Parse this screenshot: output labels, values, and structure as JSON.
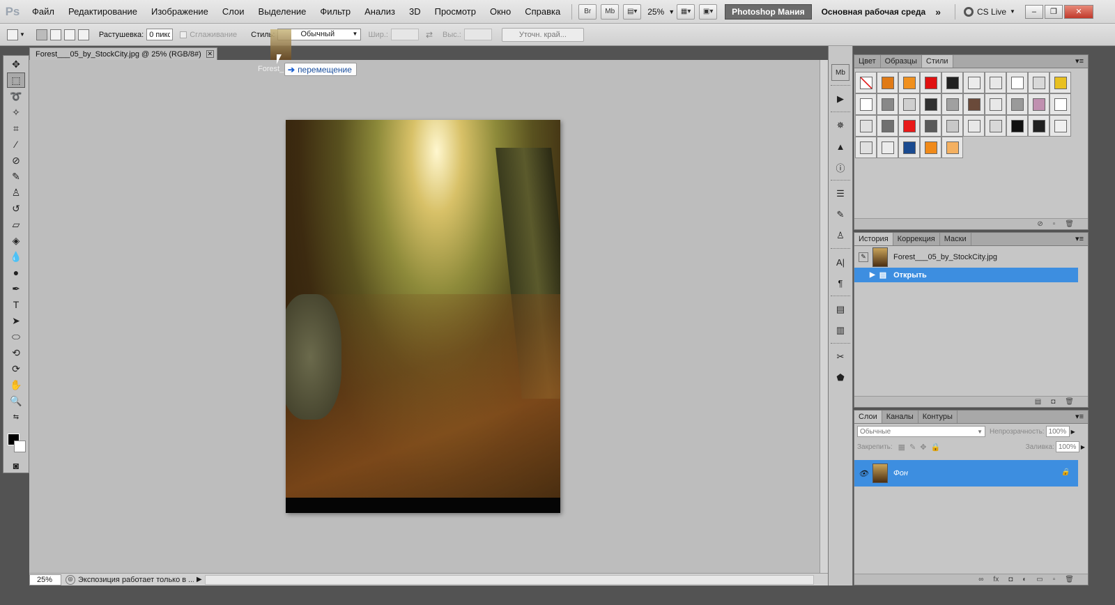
{
  "app": {
    "logo": "Ps"
  },
  "menu": [
    "Файл",
    "Редактирование",
    "Изображение",
    "Слои",
    "Выделение",
    "Фильтр",
    "Анализ",
    "3D",
    "Просмотр",
    "Окно",
    "Справка"
  ],
  "menubar": {
    "bridge_btn": "Br",
    "minibridge_btn": "Mb",
    "zoom": "25%",
    "ps_mania": "Photoshop Мания",
    "workspace": "Основная рабочая среда",
    "more": "»",
    "cslive": "CS Live"
  },
  "options": {
    "feather_label": "Растушевка:",
    "feather_value": "0 пикс.",
    "antialias_label": "Сглаживание",
    "style_label": "Стиль:",
    "style_value": "Обычный",
    "width_label": "Шир.:",
    "height_label": "Выс.:",
    "refine_edge": "Уточн. край..."
  },
  "document": {
    "tab_title": "Forest___05_by_StockCity.jpg @ 25% (RGB/8#)",
    "drag_label": "Forest_",
    "tooltip": "перемещение",
    "zoom": "25%",
    "status_text": "Экспозиция работает только в ..."
  },
  "styles_panel": {
    "tabs": [
      "Цвет",
      "Образцы",
      "Стили"
    ],
    "active": 2,
    "swatches": [
      "#ffffff",
      "#e07a16",
      "#f0901e",
      "#e01010",
      "#202020",
      "#ececec",
      "#e8e8e8",
      "#ffffff",
      "#d8d8d8",
      "#e8c020",
      "#ffffff",
      "#888888",
      "#cfcfcf",
      "#303030",
      "#a0a0a0",
      "#6a4a3a",
      "#e8e8e8",
      "#9a9a9a",
      "#c090b0",
      "#ffffff",
      "#e0e0e0",
      "#707070",
      "#e81818",
      "#5a5a5a",
      "#c8c8c8",
      "#e8e8e8",
      "#d8d8d8",
      "#101010",
      "#202020",
      "#f0f0f0",
      "#e0e0e0",
      "#ececec",
      "#1a4a90",
      "#f08a1a",
      "#f4b060"
    ]
  },
  "history_panel": {
    "tabs": [
      "История",
      "Коррекция",
      "Маски"
    ],
    "active": 0,
    "snapshot": "Forest___05_by_StockCity.jpg",
    "steps": [
      "Открыть"
    ]
  },
  "layers_panel": {
    "tabs": [
      "Слои",
      "Каналы",
      "Контуры"
    ],
    "active": 0,
    "blend_mode": "Обычные",
    "opacity_label": "Непрозрачность:",
    "opacity_value": "100%",
    "lock_label": "Закрепить:",
    "fill_label": "Заливка:",
    "fill_value": "100%",
    "layers": [
      {
        "name": "Фон"
      }
    ]
  }
}
